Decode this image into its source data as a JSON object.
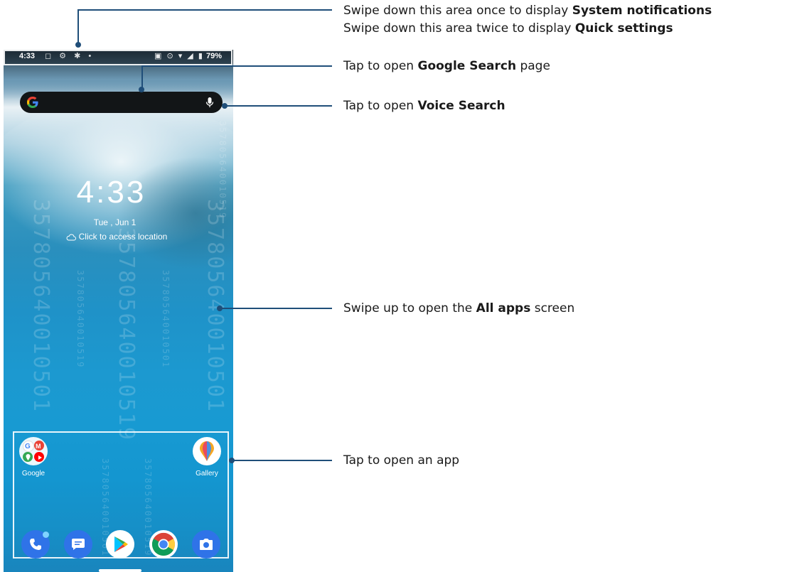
{
  "phone": {
    "status_time": "4:33",
    "battery": "79%",
    "clock": "4:33",
    "date": "Tue , Jun 1",
    "location": "Click to access location",
    "watermark": "357805640010501",
    "watermark_alt": "357805640010519",
    "apps": [
      {
        "label": "Google",
        "icon": "google-folder-icon"
      },
      {
        "label": "Gallery",
        "icon": "gallery-icon"
      }
    ],
    "dock": [
      {
        "icon": "phone-icon"
      },
      {
        "icon": "messages-icon"
      },
      {
        "icon": "play-store-icon"
      },
      {
        "icon": "chrome-icon"
      },
      {
        "icon": "camera-icon"
      }
    ]
  },
  "callouts": {
    "status_line1_pre": "Swipe down this area once to display ",
    "status_line1_bold": "System notifications",
    "status_line2_pre": "Swipe down this area twice to display ",
    "status_line2_bold": "Quick settings",
    "search_pre": "Tap to open ",
    "search_bold": "Google Search",
    "search_post": " page",
    "voice_pre": "Tap to open ",
    "voice_bold": "Voice Search",
    "allapps_pre": "Swipe up to open the ",
    "allapps_bold": "All apps",
    "allapps_post": " screen",
    "app_text": "Tap to open an app"
  },
  "colors": {
    "callout_line": "#1f4e79",
    "accent_blue": "#2f73e8"
  }
}
